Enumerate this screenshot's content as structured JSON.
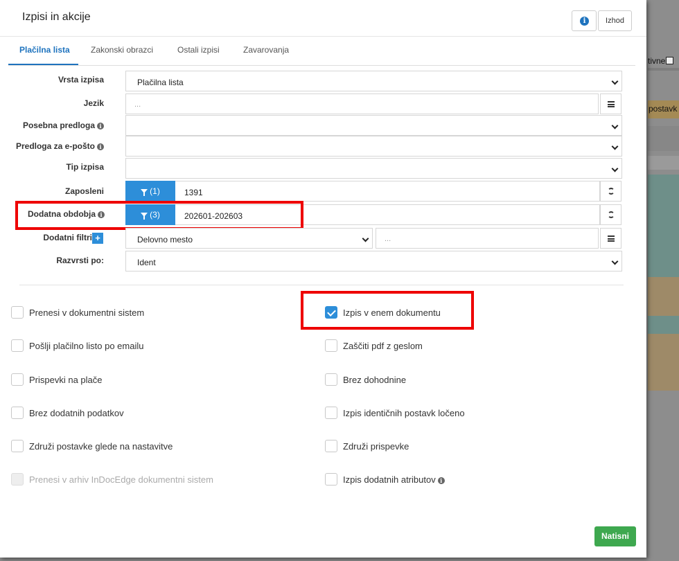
{
  "background": {
    "text_active": "tivne",
    "text_postavk": "postavk"
  },
  "modal": {
    "title": "Izpisi in akcije",
    "info_icon": "info-icon",
    "exit_label": "Izhod"
  },
  "tabs": [
    {
      "label": "Plačilna lista",
      "active": true
    },
    {
      "label": "Zakonski obrazci",
      "active": false
    },
    {
      "label": "Ostali izpisi",
      "active": false
    },
    {
      "label": "Zavarovanja",
      "active": false
    }
  ],
  "form": {
    "report_type": {
      "label": "Vrsta izpisa",
      "value": "Plačilna lista"
    },
    "language": {
      "label": "Jezik",
      "placeholder": "..."
    },
    "special_template": {
      "label": "Posebna predloga",
      "value": ""
    },
    "email_template": {
      "label": "Predloga za e-pošto",
      "value": ""
    },
    "print_type": {
      "label": "Tip izpisa",
      "value": ""
    },
    "employees": {
      "label": "Zaposleni",
      "filter_count": "(1)",
      "value": "1391"
    },
    "extra_periods": {
      "label": "Dodatna obdobja",
      "filter_count": "(3)",
      "value": "202601-202603"
    },
    "extra_filters": {
      "label": "Dodatni filtri",
      "plus": "+",
      "value": "Delovno mesto",
      "placeholder": "..."
    },
    "sort_by": {
      "label": "Razvrsti po:",
      "value": "Ident"
    }
  },
  "options_left": [
    {
      "label": "Prenesi v dokumentni sistem",
      "checked": false,
      "disabled": false
    },
    {
      "label": "Pošlji plačilno listo po emailu",
      "checked": false,
      "disabled": false
    },
    {
      "label": "Prispevki na plače",
      "checked": false,
      "disabled": false
    },
    {
      "label": "Brez dodatnih podatkov",
      "checked": false,
      "disabled": false
    },
    {
      "label": "Združi postavke glede na nastavitve",
      "checked": false,
      "disabled": false
    },
    {
      "label": "Prenesi v arhiv InDocEdge dokumentni sistem",
      "checked": false,
      "disabled": true
    }
  ],
  "options_right": [
    {
      "label": "Izpis v enem dokumentu",
      "checked": true,
      "disabled": false
    },
    {
      "label": "Zaščiti pdf z geslom",
      "checked": false,
      "disabled": false
    },
    {
      "label": "Brez dohodnine",
      "checked": false,
      "disabled": false
    },
    {
      "label": "Izpis identičnih postavk ločeno",
      "checked": false,
      "disabled": false
    },
    {
      "label": "Združi prispevke",
      "checked": false,
      "disabled": false
    },
    {
      "label": "Izpis dodatnih atributov",
      "checked": false,
      "disabled": false
    }
  ],
  "footer": {
    "print_label": "Natisni"
  },
  "colors": {
    "accent": "#2d8ed9",
    "tab_active": "#1e73be",
    "print_button": "#3ea84f",
    "highlight": "#e00000"
  }
}
